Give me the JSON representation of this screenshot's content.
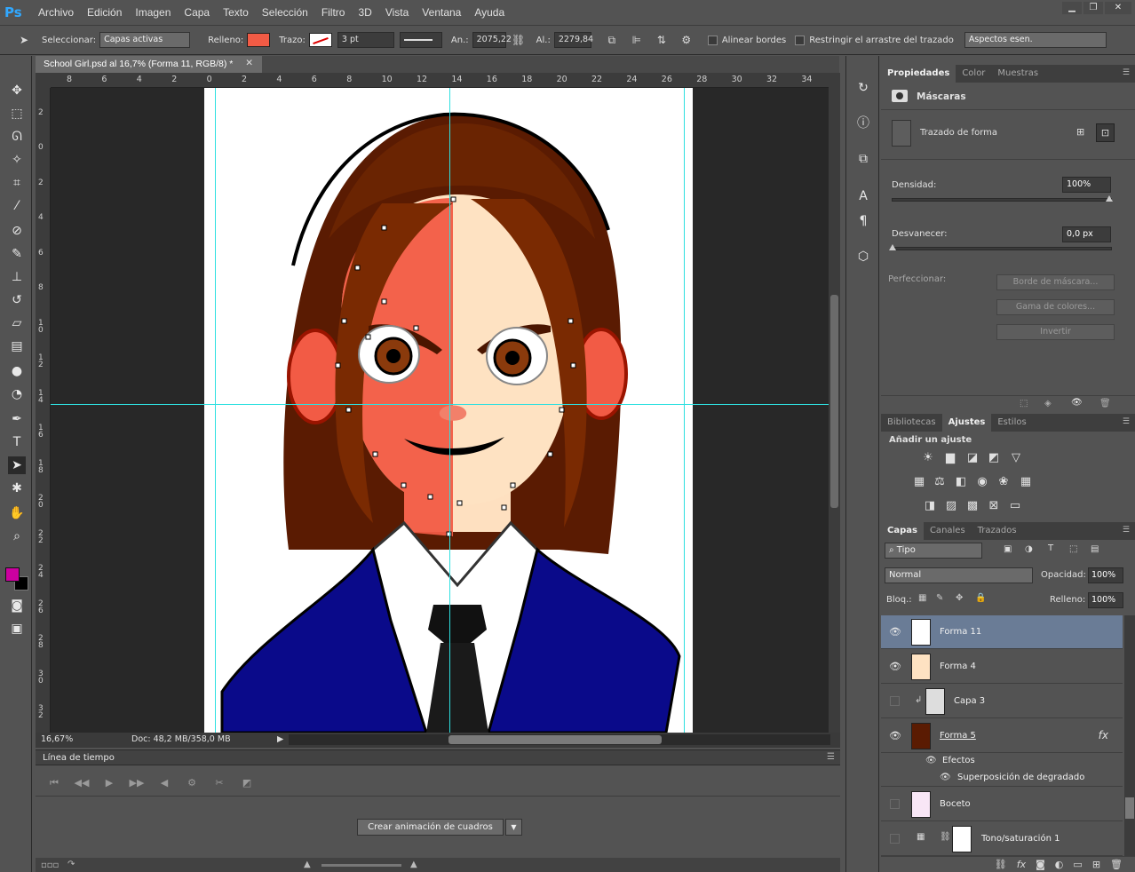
{
  "app": {
    "logo": "Ps",
    "menu": [
      "Archivo",
      "Edición",
      "Imagen",
      "Capa",
      "Texto",
      "Selección",
      "Filtro",
      "3D",
      "Vista",
      "Ventana",
      "Ayuda"
    ],
    "window_controls": {
      "minimize": "▁",
      "restore": "❐",
      "close": "✕"
    }
  },
  "options_bar": {
    "select_label": "Seleccionar:",
    "select_value": "Capas activas",
    "fill_label": "Relleno:",
    "stroke_label": "Trazo:",
    "stroke_width": "3 pt",
    "width_label": "An.:",
    "width_value": "2075,22",
    "height_label": "Al.:",
    "height_value": "2279,84",
    "align_edges": "Alinear bordes",
    "constrain": "Restringir el arrastre del trazado",
    "workspace": "Aspectos esen.",
    "fill_color": "#f25b45"
  },
  "document": {
    "tab_title": "School Girl.psd al 16,7% (Forma 11, RGB/8) *",
    "zoom": "16,67%",
    "doc_info": "Doc: 48,2 MB/358,0 MB"
  },
  "rulers": {
    "top": [
      "8",
      "6",
      "4",
      "2",
      "0",
      "2",
      "4",
      "6",
      "8",
      "10",
      "12",
      "14",
      "16",
      "18",
      "20",
      "22",
      "24",
      "26",
      "28",
      "30",
      "32",
      "34"
    ],
    "left": [
      "4",
      "2",
      "0",
      "2",
      "4",
      "6",
      "8",
      "10",
      "12",
      "14",
      "16",
      "18",
      "20",
      "22",
      "24",
      "26",
      "28",
      "30",
      "32",
      "34",
      "36",
      "38"
    ]
  },
  "timeline": {
    "title": "Línea de tiempo",
    "create_button": "Crear animación de cuadros"
  },
  "properties": {
    "tabs": [
      "Propiedades",
      "Color",
      "Muestras"
    ],
    "section": "Máscaras",
    "path_label": "Trazado de forma",
    "density_label": "Densidad:",
    "density_value": "100%",
    "feather_label": "Desvanecer:",
    "feather_value": "0,0 px",
    "refine_label": "Perfeccionar:",
    "mask_edge": "Borde de máscara...",
    "color_range": "Gama de colores...",
    "invert": "Invertir"
  },
  "adjustments": {
    "tabs": [
      "Bibliotecas",
      "Ajustes",
      "Estilos"
    ],
    "title": "Añadir un ajuste"
  },
  "layers": {
    "tabs": [
      "Capas",
      "Canales",
      "Trazados"
    ],
    "filter": "Tipo",
    "blend_mode": "Normal",
    "opacity_label": "Opacidad:",
    "opacity_value": "100%",
    "lock_label": "Bloq.:",
    "fill_label": "Relleno:",
    "fill_value": "100%",
    "items": [
      {
        "name": "Forma 11"
      },
      {
        "name": "Forma 4"
      },
      {
        "name": "Capa 3"
      },
      {
        "name": "Forma 5"
      },
      {
        "name": "Efectos"
      },
      {
        "name": "Superposición de degradado"
      },
      {
        "name": "Boceto"
      },
      {
        "name": "Tono/saturación 1"
      }
    ],
    "fx": "fx"
  }
}
